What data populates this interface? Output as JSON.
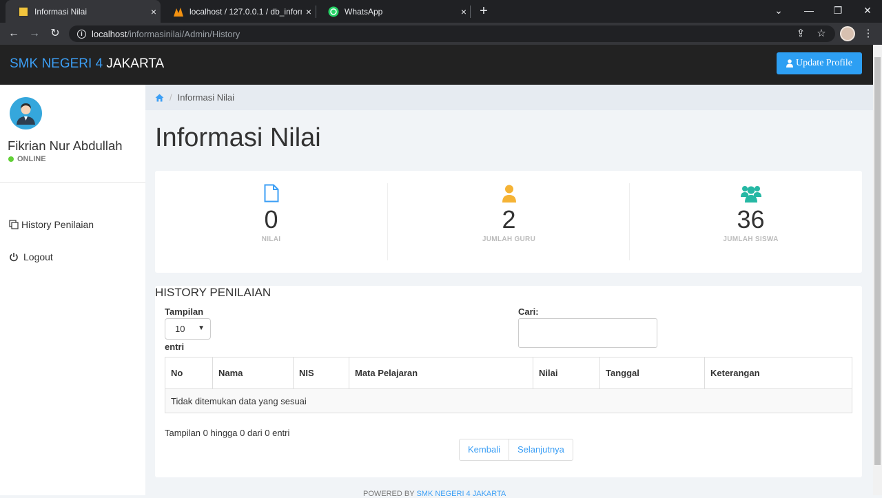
{
  "browser": {
    "tabs": [
      {
        "title": "Informasi Nilai",
        "close": "×"
      },
      {
        "title": "localhost / 127.0.0.1 / db_informa",
        "close": "×"
      },
      {
        "title": "WhatsApp",
        "close": "×"
      }
    ],
    "new_tab": "+",
    "url_host": "localhost",
    "url_path": "/informasinilai/Admin/History"
  },
  "app": {
    "brand_part1": "SMK NEGERI 4",
    "brand_part2": " JAKARTA",
    "update_profile_label": "Update Profile"
  },
  "sidebar": {
    "user_name": "Fikrian Nur Abdullah",
    "status": "ONLINE",
    "items": [
      {
        "label": "History Penilaian"
      },
      {
        "label": "Logout"
      }
    ]
  },
  "breadcrumb": {
    "sep": "/",
    "current": "Informasi Nilai"
  },
  "page_title": "Informasi Nilai",
  "stats": [
    {
      "value": "0",
      "label": "NILAI",
      "color": "#3c9ff5"
    },
    {
      "value": "2",
      "label": "JUMLAH GURU",
      "color": "#f5b335"
    },
    {
      "value": "36",
      "label": "JUMLAH SISWA",
      "color": "#26b8a4"
    }
  ],
  "history": {
    "title": "HISTORY PENILAIAN",
    "show_label": "Tampilan",
    "show_value": "10",
    "entries_label": "entri",
    "search_label": "Cari:",
    "columns": [
      "No",
      "Nama",
      "NIS",
      "Mata Pelajaran",
      "Nilai",
      "Tanggal",
      "Keterangan"
    ],
    "empty_text": "Tidak ditemukan data yang sesuai",
    "info": "Tampilan 0 hingga 0 dari 0 entri",
    "prev_label": "Kembali",
    "next_label": "Selanjutnya"
  },
  "footer": {
    "prefix": "POWERED BY ",
    "link": "SMK NEGERI 4 JAKARTA"
  }
}
